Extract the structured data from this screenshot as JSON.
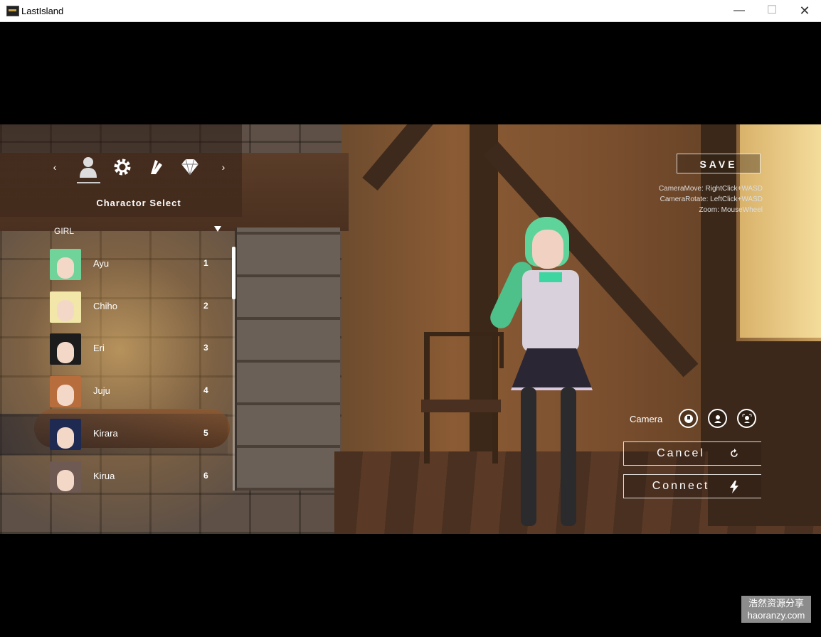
{
  "window": {
    "title": "LastIsland",
    "minimize": "—",
    "maximize": "☐",
    "close": "✕"
  },
  "nav": {
    "prev": "‹",
    "next": "›"
  },
  "section_title": "Charactor Select",
  "category": "GIRL",
  "characters": [
    {
      "name": "Ayu",
      "num": "1",
      "hair": "#6fd39a"
    },
    {
      "name": "Chiho",
      "num": "2",
      "hair": "#f2e7a8"
    },
    {
      "name": "Eri",
      "num": "3",
      "hair": "#1c1c1c"
    },
    {
      "name": "Juju",
      "num": "4",
      "hair": "#b86d3d"
    },
    {
      "name": "Kirara",
      "num": "5",
      "hair": "#1f2a52"
    },
    {
      "name": "Kirua",
      "num": "6",
      "hair": "#6e5a52"
    }
  ],
  "selected_index": 4,
  "save_label": "SAVE",
  "help": {
    "move": "CameraMove: RightClick+WASD",
    "rotate": "CameraRotate: LeftClick+WASD",
    "zoom": "Zoom: MouseWheel"
  },
  "camera_label": "Camera",
  "cancel_label": "Cancel",
  "connect_label": "Connect",
  "watermark": {
    "line1": "浩然资源分享",
    "line2": "haoranzy.com"
  }
}
